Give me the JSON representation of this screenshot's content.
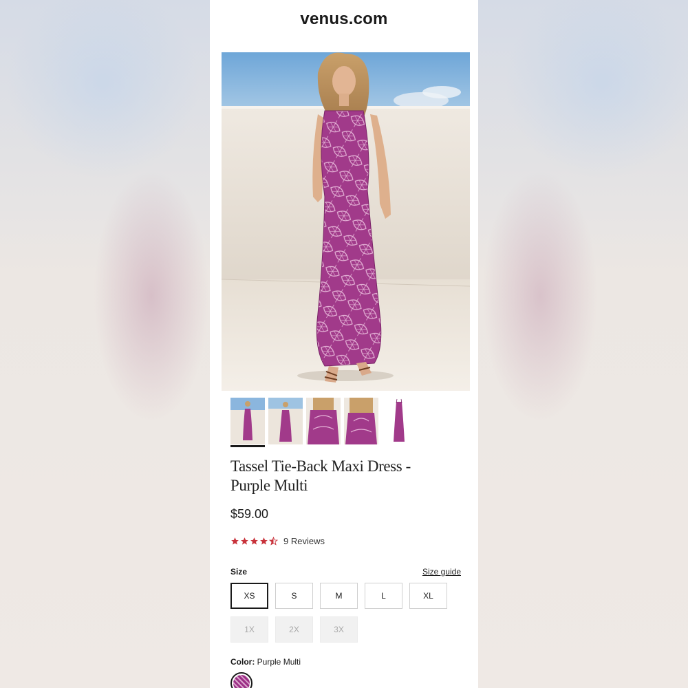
{
  "site": {
    "title": "venus.com"
  },
  "product": {
    "title_line1": "Tassel Tie-Back Maxi Dress -",
    "title_line2": "Purple Multi",
    "price": "$59.00",
    "rating": 4.5,
    "reviews_label": "9 Reviews",
    "thumbnails": [
      "front-view",
      "back-view",
      "detail-front",
      "detail-back",
      "flat-lay"
    ],
    "selected_thumbnail": 0
  },
  "size": {
    "label": "Size",
    "guide_label": "Size guide",
    "selected": "XS",
    "options": [
      {
        "label": "XS",
        "available": true
      },
      {
        "label": "S",
        "available": true
      },
      {
        "label": "M",
        "available": true
      },
      {
        "label": "L",
        "available": true
      },
      {
        "label": "XL",
        "available": true
      },
      {
        "label": "1X",
        "available": false
      },
      {
        "label": "2X",
        "available": false
      },
      {
        "label": "3X",
        "available": false
      }
    ]
  },
  "color": {
    "label": "Color:",
    "value": "Purple Multi"
  },
  "colors": {
    "dress_purple": "#9c2f86",
    "star_red": "#c8323b",
    "text": "#1a1a1a"
  }
}
